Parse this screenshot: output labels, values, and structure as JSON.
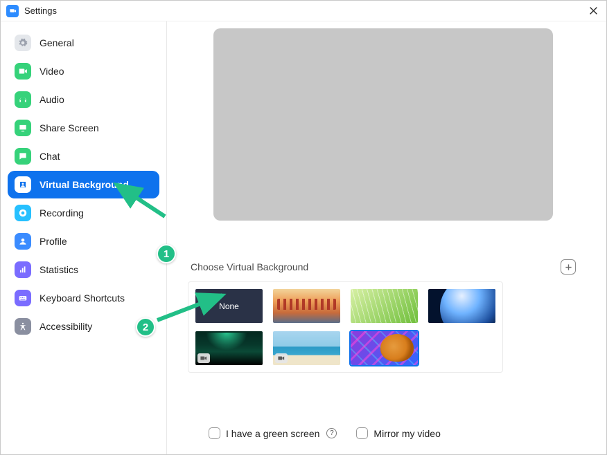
{
  "window": {
    "title": "Settings"
  },
  "sidebar": {
    "items": [
      {
        "label": "General",
        "icon": "gear",
        "bg": "#e4e7eb"
      },
      {
        "label": "Video",
        "icon": "video",
        "bg": "#36d27a"
      },
      {
        "label": "Audio",
        "icon": "audio",
        "bg": "#36d27a"
      },
      {
        "label": "Share Screen",
        "icon": "share",
        "bg": "#36d27a"
      },
      {
        "label": "Chat",
        "icon": "chat",
        "bg": "#36d27a"
      },
      {
        "label": "Virtual Background",
        "icon": "vbg",
        "bg": "#ffffff",
        "selected": true
      },
      {
        "label": "Recording",
        "icon": "rec",
        "bg": "#26c0ff"
      },
      {
        "label": "Profile",
        "icon": "profile",
        "bg": "#3b8cff"
      },
      {
        "label": "Statistics",
        "icon": "stats",
        "bg": "#7a6cff"
      },
      {
        "label": "Keyboard Shortcuts",
        "icon": "kbd",
        "bg": "#7a6cff"
      },
      {
        "label": "Accessibility",
        "icon": "a11y",
        "bg": "#8a8fa0"
      }
    ]
  },
  "content": {
    "section_label": "Choose Virtual Background",
    "thumbs": [
      {
        "kind": "none",
        "label": "None"
      },
      {
        "kind": "bridge"
      },
      {
        "kind": "grass"
      },
      {
        "kind": "earth"
      },
      {
        "kind": "aurora",
        "video": true
      },
      {
        "kind": "beach",
        "video": true
      },
      {
        "kind": "tiger",
        "selected": true
      }
    ],
    "options": {
      "green_screen": "I have a green screen",
      "mirror": "Mirror my video"
    }
  },
  "annotations": {
    "badge1": "1",
    "badge2": "2"
  }
}
